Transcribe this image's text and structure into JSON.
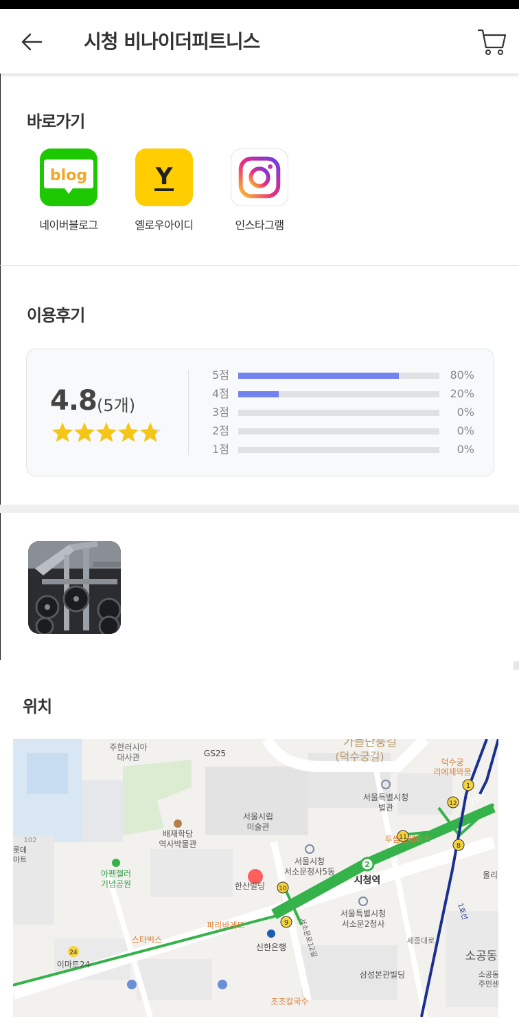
{
  "header": {
    "title": "시청 비나이더피트니스"
  },
  "shortcuts": {
    "title": "바로가기",
    "items": [
      {
        "label": "네이버블로그",
        "icon": "blog-icon",
        "icon_text": "blog"
      },
      {
        "label": "옐로우아이디",
        "icon": "yellow-id-icon",
        "icon_text": "Y"
      },
      {
        "label": "인스타그램",
        "icon": "instagram-icon"
      }
    ]
  },
  "reviews": {
    "title": "이용후기",
    "average": "4.8",
    "count_text": "(5개)",
    "rating_value": 4.8,
    "rating_max": 5,
    "distribution": [
      {
        "label": "5점",
        "percent_text": "80%",
        "fraction": 0.8
      },
      {
        "label": "4점",
        "percent_text": "20%",
        "fraction": 0.2
      },
      {
        "label": "3점",
        "percent_text": "0%",
        "fraction": 0
      },
      {
        "label": "2점",
        "percent_text": "0%",
        "fraction": 0
      },
      {
        "label": "1점",
        "percent_text": "0%",
        "fraction": 0
      }
    ],
    "colors": {
      "bar_fill": "#7282ee",
      "bar_track": "#dfe1e5",
      "star": "#f5c518",
      "star_empty": "#d8d8d8"
    }
  },
  "location": {
    "title": "위치",
    "map_labels": {
      "embassy": "주한러시아\n대사관",
      "gs25": "GS25",
      "gil": "가들단풍길",
      "deoksu_gil": "(덕수궁길)",
      "deoksu_museum": "덕수궁\n리에제와움",
      "city_hall_annex": "서울특별시청\n별관",
      "seoul_museum": "서울시립\n미술관",
      "paichai": "배재학당\n역사박물관",
      "lotte": "롯데\n마트",
      "num102": "102",
      "appenzeller": "아펜젤러\n기념공원",
      "seosomun_5": "서울시청\n서소문청사5동",
      "hansan": "한산빌딩",
      "cityhall_station": "시청역",
      "tuseom": "투썸플레이스",
      "olli": "올리",
      "paris": "파리바게뜨",
      "seosomun_2": "서울특별시청\n서소문2청사",
      "starbucks": "스타벅스",
      "shinhan": "신한은행",
      "sejong": "세종대로",
      "emart": "이마트24",
      "samsung": "삼성본관빌딩",
      "sogong": "소공동",
      "sogong_center": "소공동\n주민센",
      "jojo": "조조칼국수",
      "road12": "서소문로12길",
      "line2": "2호선",
      "line1": "1호선",
      "exit_1": "1",
      "exit_12": "12",
      "exit_11": "11",
      "exit_8": "8",
      "exit_10": "10",
      "exit_9": "9",
      "line_no_2": "2",
      "emart_no": "24"
    }
  }
}
